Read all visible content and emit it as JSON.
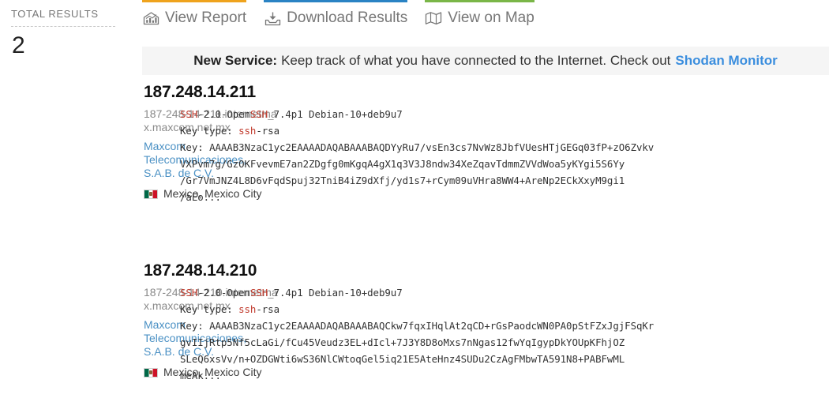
{
  "sidebar": {
    "heading": "TOTAL RESULTS",
    "count": "2"
  },
  "actionbar": {
    "items": [
      {
        "label": "View Report",
        "icon": "bar-chart-icon",
        "color": "#efa31d"
      },
      {
        "label": "Download Results",
        "icon": "download-icon",
        "color": "#2a83c4"
      },
      {
        "label": "View on Map",
        "icon": "map-icon",
        "color": "#7ab648"
      }
    ]
  },
  "notice": {
    "strong": "New Service:",
    "text": "Keep track of what you have connected to the Internet. Check out",
    "link": "Shodan Monitor",
    "link_color": "#3b8ede"
  },
  "results": [
    {
      "ip": "187.248.14.211",
      "hostname": "187-248-14-211.internetmax.maxcom.net.mx",
      "org": "Maxcom Telecomunicaciones, S.A.B. de C.V.",
      "flag": "mexico-flag",
      "location": "Mexico, Mexico City",
      "banner": {
        "line1_pre": "SSH",
        "line1_mid": "-2.0-Open",
        "line1_ssh": "SSH",
        "line1_post": "_7.4p1 Debian-10+deb9u7",
        "keytype_label": "Key type: ",
        "keytype_value": "ssh",
        "keytype_rest": "-rsa",
        "key_label": "Key: ",
        "key_lines": [
          "AAAAB3NzaC1yc2EAAAADAQABAAABAQDYyRu7/vsEn3cs7NvWz8JbfVUesHTjGEGq03fP+zO6Zvkv",
          "VXPvm7g/GzOKFvevmE7an2ZDgfg0mKgqA4gX1q3V3J8ndw34XeZqavTdmmZVVdWoa5yKYgi5S6Yy",
          "/Gr7VmJNZ4L8D6vFqdSpuj32TniB4iZ9dXfj/yd1s7+rCym09uVHra8WW4+AreNp2ECkXxyM9gi1",
          "/aEo..."
        ]
      }
    },
    {
      "ip": "187.248.14.210",
      "hostname": "187-248-14-210.internetmax.maxcom.net.mx",
      "org": "Maxcom Telecomunicaciones, S.A.B. de C.V.",
      "flag": "mexico-flag",
      "location": "Mexico, Mexico City",
      "banner": {
        "line1_pre": "SSH",
        "line1_mid": "-2.0-Open",
        "line1_ssh": "SSH",
        "line1_post": "_7.4p1 Debian-10+deb9u7",
        "keytype_label": "Key type: ",
        "keytype_value": "ssh",
        "keytype_rest": "-rsa",
        "key_label": "Key: ",
        "key_lines": [
          "AAAAB3NzaC1yc2EAAAADAQABAAABAQCkw7fqxIHqlAt2qCD+rGsPaodcWN0PA0pStFZxJgjFSqKr",
          "gvIIjRtp5Nf5cLaGi/fCu45Veudz3EL+dIcl+7J3Y8D8oMxs7nNgas12fwYqIgypDkYOUpKFhjOZ",
          "SLeQ6xsVv/n+OZDGWti6wS36NlCWtoqGel5iq21E5AteHnz4SUDu2CzAgFMbwTA591N8+PABFwML",
          "meAk..."
        ]
      }
    }
  ]
}
